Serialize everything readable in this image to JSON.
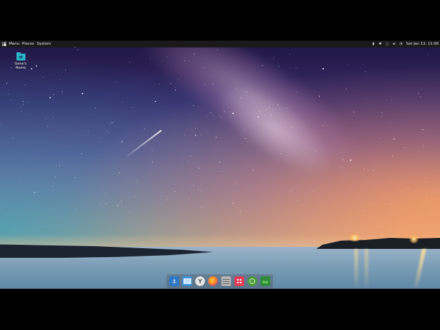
{
  "panel": {
    "menu_label": "Menu",
    "places_label": "Places",
    "system_label": "System",
    "clock_text": "Sat Jan 13, 11:06"
  },
  "desktop": {
    "icons": [
      {
        "label": "Gene's Home",
        "icon": "home-folder-icon"
      }
    ]
  },
  "dock": {
    "items": [
      {
        "name": "anchor-app-icon",
        "color": "#2a78c8"
      },
      {
        "name": "desktop-show-icon",
        "color": "#3b8fe0"
      },
      {
        "name": "yandex-browser-icon",
        "glyph": "Y",
        "color": "#e6e6e6"
      },
      {
        "name": "firefox-icon",
        "color": "#ff7a2a"
      },
      {
        "name": "file-cabinet-icon",
        "color": "#b5b5b5"
      },
      {
        "name": "app-grid-icon",
        "color": "#e63a55"
      },
      {
        "name": "update-manager-icon",
        "color": "#4a9a3a"
      },
      {
        "name": "system-monitor-icon",
        "color": "#2d8b3a"
      }
    ]
  },
  "colors": {
    "panel_bg": "#1a1a1a",
    "folder_accent": "#2fb3c9"
  }
}
